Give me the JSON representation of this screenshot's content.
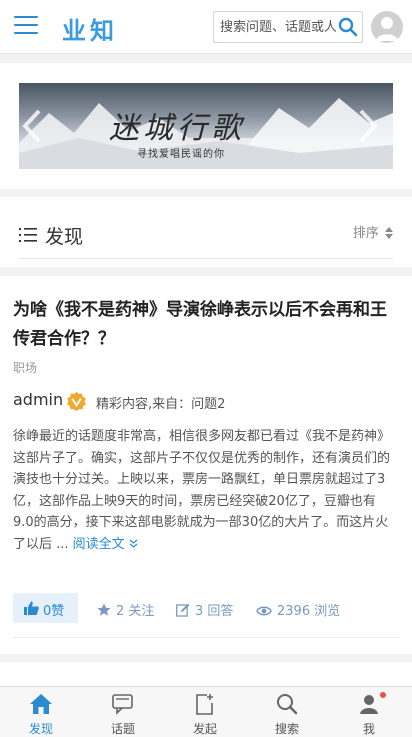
{
  "header": {
    "logo": "业知",
    "search_placeholder": "搜索问题、话题或人"
  },
  "banner": {
    "title": "迷城行歌",
    "subtitle": "寻找爱唱民谣的你"
  },
  "discover": {
    "title": "发现",
    "sort_label": "排序"
  },
  "question": {
    "title": "为啥《我不是药神》导演徐峥表示以后不会再和王传君合作？？",
    "topic": "职场",
    "user": "admin",
    "source": "精彩内容,来自：问题2",
    "body": "徐峥最近的话题度非常高，相信很多网友都已看过《我不是药神》这部片子了。确实，这部片子不仅仅是优秀的制作，还有演员们的演技也十分过关。上映以来，票房一路飘红，单日票房就超过了3亿，这部作品上映9天的时间，票房已经突破20亿了，豆瓣也有9.0的高分，接下来这部电影就成为一部30亿的大片了。而这片火了以后 ...",
    "read_more": "阅读全文",
    "likes": "0赞",
    "focus": "2 关注",
    "answers": "3 回答",
    "views": "2396 浏览"
  },
  "nav": {
    "items": [
      {
        "label": "发现",
        "icon": "home-icon"
      },
      {
        "label": "话题",
        "icon": "topic-icon"
      },
      {
        "label": "发起",
        "icon": "compose-icon"
      },
      {
        "label": "搜索",
        "icon": "search-icon"
      },
      {
        "label": "我",
        "icon": "user-icon"
      }
    ]
  },
  "colors": {
    "accent": "#2b8bd1",
    "badge": "#f0a92c",
    "notification": "#e8543f"
  }
}
